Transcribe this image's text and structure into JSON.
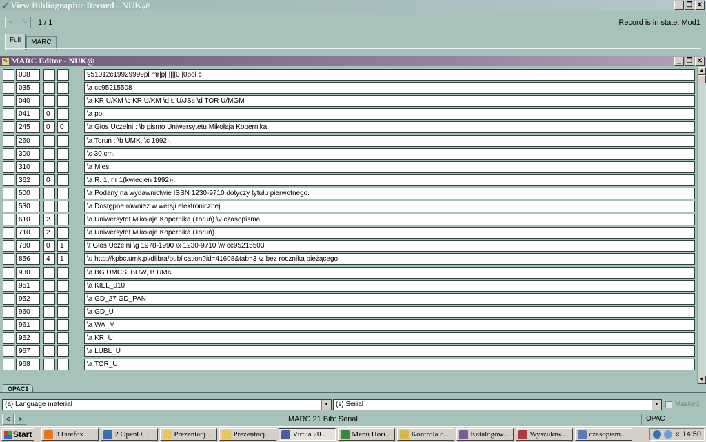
{
  "window": {
    "title": "View Bibliographic Record - NUK@",
    "page_indicator": "1 / 1",
    "record_state": "Record is in state:  Mod1",
    "nav_prev": "<",
    "nav_next": ">",
    "tabs": [
      {
        "label": "Full"
      },
      {
        "label": "MARC"
      }
    ]
  },
  "editor": {
    "title": "MARC Editor - NUK@",
    "rows": [
      {
        "tag": "008",
        "i1": "",
        "i2": "",
        "value": "951012c19929999pl mr|p|  ||||0   |0pol c"
      },
      {
        "tag": "035",
        "i1": "",
        "i2": "",
        "value": "\\a cc95215508"
      },
      {
        "tag": "040",
        "i1": "",
        "i2": "",
        "value": "\\a KR U/KM \\c KR U/KM \\d Ł U/JSs \\d TOR U/MGM"
      },
      {
        "tag": "041",
        "i1": "0",
        "i2": "",
        "value": "\\a pol"
      },
      {
        "tag": "245",
        "i1": "0",
        "i2": "0",
        "value": "\\a Głos Uczelni : \\b pismo Uniwersytetu Mikołaja Kopernika."
      },
      {
        "tag": "260",
        "i1": "",
        "i2": "",
        "value": "\\a Toruń : \\b UMK, \\c 1992-."
      },
      {
        "tag": "300",
        "i1": "",
        "i2": "",
        "value": "\\c 30 cm."
      },
      {
        "tag": "310",
        "i1": "",
        "i2": "",
        "value": "\\a Mies."
      },
      {
        "tag": "362",
        "i1": "0",
        "i2": "",
        "value": "\\a R. 1, nr 1(kwiecień 1992)-."
      },
      {
        "tag": "500",
        "i1": "",
        "i2": "",
        "value": "\\a Podany na wydawnictwie ISSN 1230-9710 dotyczy tytułu pierwotnego."
      },
      {
        "tag": "530",
        "i1": "",
        "i2": "",
        "value": "\\a Dostępne również w wersji elektronicznej"
      },
      {
        "tag": "610",
        "i1": "2",
        "i2": "",
        "value": "\\a Uniwersytet Mikołaja Kopernika (Toruń) \\v czasopisma."
      },
      {
        "tag": "710",
        "i1": "2",
        "i2": "",
        "value": "\\a Uniwersytet Mikołaja Kopernika (Toruń)."
      },
      {
        "tag": "780",
        "i1": "0",
        "i2": "1",
        "value": "\\t Głos Uczelni \\g 1978-1990 \\x 1230-9710 \\w cc95215503"
      },
      {
        "tag": "856",
        "i1": "4",
        "i2": "1",
        "value": "\\u http://kpbc.umk.pl/dlibra/publication?id=41608&tab=3 \\z bez rocznika bieżącego"
      },
      {
        "tag": "930",
        "i1": "",
        "i2": "",
        "value": "\\a BG UMCS, BUW, B UMK"
      },
      {
        "tag": "951",
        "i1": "",
        "i2": "",
        "value": "\\a KIEL_010"
      },
      {
        "tag": "952",
        "i1": "",
        "i2": "",
        "value": "\\a GD_27 GD_PAN"
      },
      {
        "tag": "960",
        "i1": "",
        "i2": "",
        "value": "\\a GD_U"
      },
      {
        "tag": "961",
        "i1": "",
        "i2": "",
        "value": "\\a WA_M"
      },
      {
        "tag": "962",
        "i1": "",
        "i2": "",
        "value": "\\a KR_U"
      },
      {
        "tag": "967",
        "i1": "",
        "i2": "",
        "value": "\\a LUBL_U"
      },
      {
        "tag": "968",
        "i1": "",
        "i2": "",
        "value": "\\a TOR_U"
      }
    ]
  },
  "bottom": {
    "opac_tab": "OPAC1",
    "material_type": "(a) Language material",
    "bib_level": "(s) Serial",
    "masked_label": "Masked",
    "status_center": "MARC 21 Bib: Serial",
    "status_right": "OPAC"
  },
  "taskbar": {
    "start_label": "Start",
    "items": [
      {
        "label": "3 Firefox",
        "color": "#e8741c"
      },
      {
        "label": "2 OpenO...",
        "color": "#3a6fb5"
      },
      {
        "label": "Prezentacj...",
        "color": "#e8c65a"
      },
      {
        "label": "Prezentacj...",
        "color": "#e8c65a"
      },
      {
        "label": "Virtua 20...",
        "color": "#4a5ea8",
        "active": true
      },
      {
        "label": "Menu Hori...",
        "color": "#3a8a3a"
      },
      {
        "label": "Kontrola c...",
        "color": "#d8b84a"
      },
      {
        "label": "Katalogow...",
        "color": "#7a5a9a"
      },
      {
        "label": "Wyszukiw...",
        "color": "#b03a3a"
      },
      {
        "label": "czasopism...",
        "color": "#5a7ab8"
      }
    ],
    "tray_expand": "«",
    "clock": "14:50"
  },
  "icons": {
    "minimize": "minimize-icon",
    "restore": "restore-icon",
    "close": "close-icon"
  }
}
